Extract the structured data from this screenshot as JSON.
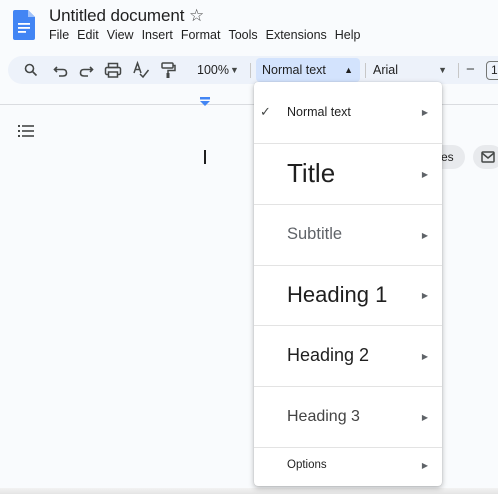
{
  "document": {
    "title": "Untitled document"
  },
  "menubar": {
    "items": [
      "File",
      "Edit",
      "View",
      "Insert",
      "Format",
      "Tools",
      "Extensions",
      "Help"
    ]
  },
  "toolbar": {
    "zoom": "100%",
    "paragraph_style": "Normal text",
    "font": "Arial",
    "font_size": "1"
  },
  "chip": {
    "label": "es"
  },
  "style_menu": {
    "items": [
      {
        "label": "Normal text",
        "checked": true
      },
      {
        "label": "Title"
      },
      {
        "label": "Subtitle"
      },
      {
        "label": "Heading 1"
      },
      {
        "label": "Heading 2"
      },
      {
        "label": "Heading 3"
      },
      {
        "label": "Options"
      }
    ]
  },
  "colors": {
    "brand": "#4285f4",
    "selection": "#d3e3fd"
  }
}
